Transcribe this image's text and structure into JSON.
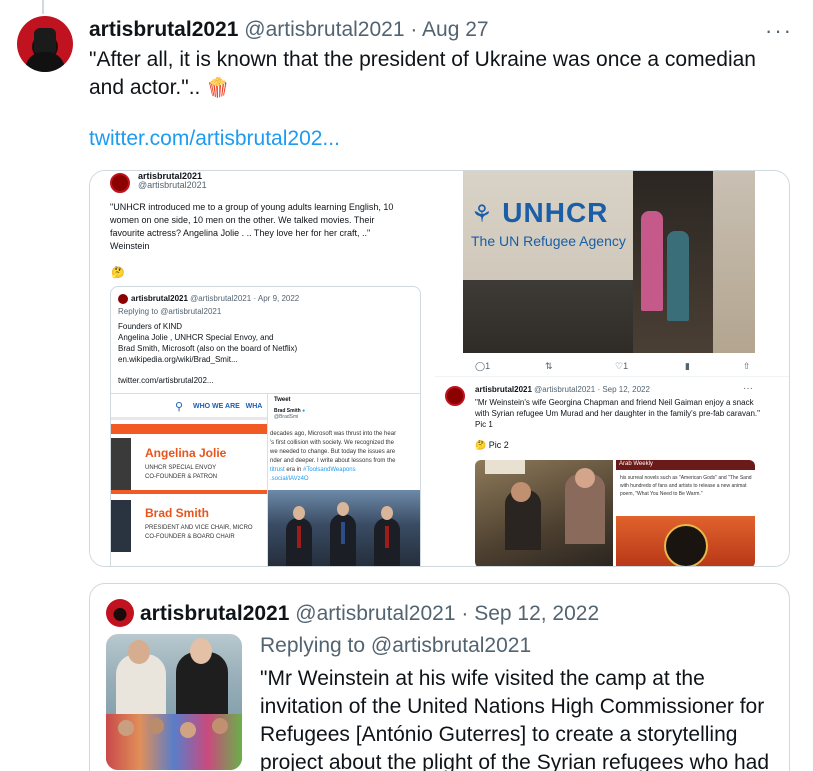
{
  "tweet": {
    "author_name": "artisbrutal2021",
    "author_handle": "@artisbrutal2021",
    "separator": "·",
    "date": "Aug 27",
    "more_label": "···",
    "text": "\"After all, it is known that the president of Ukraine was once a comedian and actor.\"..",
    "emoji_name": "popcorn-icon",
    "emoji_glyph": "🍿",
    "link": "twitter.com/artisbrutal202..."
  },
  "media_left": {
    "author_name": "artisbrutal2021",
    "author_handle": "@artisbrutal2021",
    "text": "\"UNHCR introduced me to a group of young adults learning English, 10 women on one side, 10 men on the other. We talked movies. Their favourite actress? Angelina Jolie . .. They love her for her craft, ..\" Weinstein",
    "emoji_glyph": "🤔",
    "quote": {
      "author_name": "artisbrutal2021",
      "author_handle": "@artisbrutal2021",
      "date": "Apr 9, 2022",
      "replying": "Replying to @artisbrutal2021",
      "lines": [
        "Founders of KIND",
        "Angelina Jolie , UNHCR Special Envoy, and",
        "Brad Smith, Microsoft (also on the board of Netflix)",
        "en.wikipedia.org/wiki/Brad_Smit..."
      ],
      "link": "twitter.com/artisbrutal202..."
    },
    "web": {
      "nav_label": "WHO WE ARE",
      "nav_more": "WHA",
      "people": [
        {
          "name": "Angelina Jolie",
          "role_1": "UNHCR SPECIAL ENVOY",
          "role_2": "CO-FOUNDER & PATRON"
        },
        {
          "name": "Brad Smith",
          "role_1": "PRESIDENT AND VICE CHAIR, MICRO",
          "role_2": "CO-FOUNDER & BOARD CHAIR"
        }
      ]
    },
    "tweet_shot": {
      "title": "Tweet",
      "author": "Brad Smith",
      "handle": "@BradSmi",
      "body_1": "decades ago, Microsoft was thrust into the hear",
      "body_2": "'s first collision with society. We recognized the",
      "body_3": "we needed to change. But today the issues are",
      "body_4": "nder and deeper. I write about lessons from the",
      "body_5": "titrust",
      "body_5b": " era in ",
      "body_5c": "#ToolsandWeapons",
      "body_6": ".social/lAVz4O"
    }
  },
  "media_right": {
    "tent_logo": "UNHCR",
    "tent_sub": "The UN Refugee Agency",
    "actions": [
      "1",
      "",
      "1",
      "",
      ""
    ],
    "author_name": "artisbrutal2021",
    "author_handle": "@artisbrutal2021",
    "date": "Sep 12, 2022",
    "more_label": "···",
    "text": "\"Mr Weinstein's wife Georgina Chapman and friend Neil Gaiman enjoy a snack with Syrian refugee Um Murad and her daughter in the family's pre-fab caravan.\" Pic 1",
    "pic_emoji": "🤔",
    "pic_label": "Pic 2",
    "article_bar": "Arab Weekly",
    "article_text": "his surreal novels such as \"American Gods\" and \"The Sand with hundreds of fans and artists to release a new animat poem, \"What You Need to Be Warm.\""
  },
  "quoted": {
    "author_name": "artisbrutal2021",
    "author_handle": "@artisbrutal2021",
    "separator": "·",
    "date": "Sep 12, 2022",
    "replying": "Replying to @artisbrutal2021",
    "text": "\"Mr Weinstein at his wife visited the camp at the invitation of the United Nations High Commissioner for Refugees [António Guterres] to create a storytelling project about the plight of the Syrian refugees who had"
  },
  "colors": {
    "accent": "#1d9bf0",
    "secondary_text": "#536471",
    "border": "#cfd9de",
    "unhcr_blue": "#1a5ea8",
    "kind_orange": "#e8541b"
  }
}
